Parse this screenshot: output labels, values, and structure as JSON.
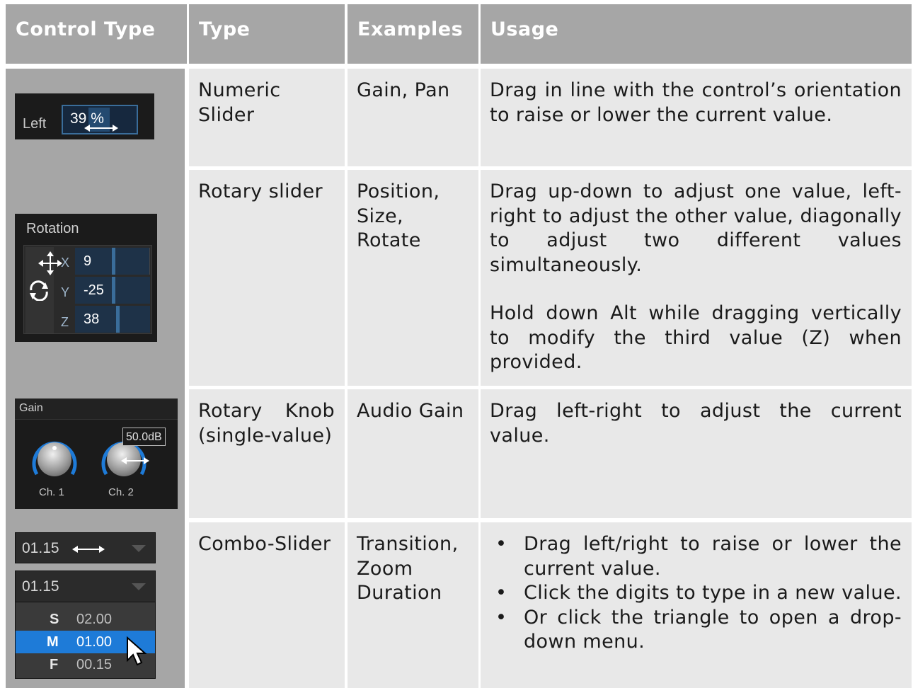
{
  "table": {
    "headers": [
      "Control Type",
      "Type",
      "Examples",
      "Usage"
    ],
    "rows": [
      {
        "type": "Numeric Slider",
        "examples": "Gain, Pan",
        "usage": [
          "Drag in line with the control’s orientation to raise or lower the current value."
        ],
        "widget": {
          "label": "Left",
          "value": "39 %"
        }
      },
      {
        "type": "Rotary slider",
        "examples": [
          "Position,",
          "Size,",
          "Rotate"
        ],
        "usage": [
          "Drag up-down to adjust one value, left-right to adjust the other value, diagonally to adjust two different values simultaneously.",
          "Hold down Alt while dragging vertically to modify the third value (Z) when provided."
        ],
        "widget": {
          "title": "Rotation",
          "x_label": "X",
          "x_value": "9",
          "y_label": "Y",
          "y_value": "-25",
          "z_label": "Z",
          "z_value": "38"
        }
      },
      {
        "type": "Rotary Knob (single-value)",
        "examples": "Audio Gain",
        "usage": [
          "Drag left-right to adjust the current value."
        ],
        "widget": {
          "title": "Gain",
          "knob1_label": "Ch. 1",
          "knob2_label": "Ch. 2",
          "tooltip": "50.0dB"
        }
      },
      {
        "type": "Combo-Slider",
        "examples": [
          "Transition,",
          "Zoom",
          "Duration"
        ],
        "usage": [
          "Drag left/right to raise or lower the current value.",
          "Click the digits to type in a new value.",
          "Or click the triangle to open a drop-down menu."
        ],
        "widget": {
          "value1": "01.15",
          "value2": "01.15",
          "menu": [
            {
              "key": "S",
              "value": "02.00"
            },
            {
              "key": "M",
              "value": "01.00"
            },
            {
              "key": "F",
              "value": "00.15"
            }
          ]
        }
      }
    ]
  },
  "colors": {
    "header_bg": "#a6a6a6",
    "cell_bg": "#e8e8e8",
    "accent_blue": "#1e7bd8"
  }
}
